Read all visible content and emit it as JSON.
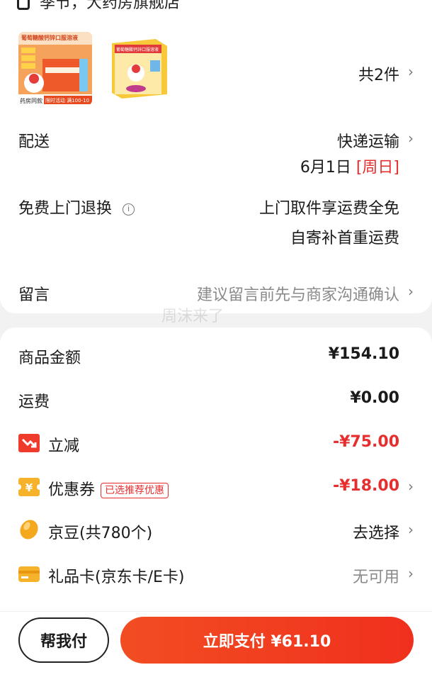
{
  "header_stub": {
    "text": "季节，大药房旗舰店"
  },
  "order": {
    "count_label": "共2件",
    "product1_banner": "葡萄糖酸钙锌口服溶液",
    "product1_promo": "限时活动 满100-10",
    "product1_tag": "药房同款",
    "product2_banner": "葡萄糖酸钙锌口服溶液"
  },
  "delivery": {
    "label": "配送",
    "method": "快递运输",
    "date": "6月1日",
    "weekday": "[周日]"
  },
  "returns": {
    "label": "免费上门退换",
    "line1": "上门取件享运费全免",
    "line2": "自寄补首重运费"
  },
  "message": {
    "label": "留言",
    "placeholder": "建议留言前先与商家沟通确认"
  },
  "watermark": "周沫来了",
  "summary": {
    "goods_label": "商品金额",
    "goods_value": "¥154.10",
    "shipping_label": "运费",
    "shipping_value": "¥0.00",
    "discount_label": "立减",
    "discount_value": "-¥75.00",
    "coupon_label": "优惠券",
    "coupon_badge": "已选推荐优惠",
    "coupon_value": "-¥18.00",
    "beans_label": "京豆(共780个)",
    "beans_value": "去选择",
    "giftcard_label": "礼品卡(京东卡/E卡)",
    "giftcard_value": "无可用"
  },
  "actions": {
    "help_pay": "帮我付",
    "pay_now": "立即支付 ¥61.10"
  },
  "colors": {
    "accent": "#f0301e",
    "discount_red": "#e62e2e",
    "coupon_gold": "#f6b22a"
  }
}
